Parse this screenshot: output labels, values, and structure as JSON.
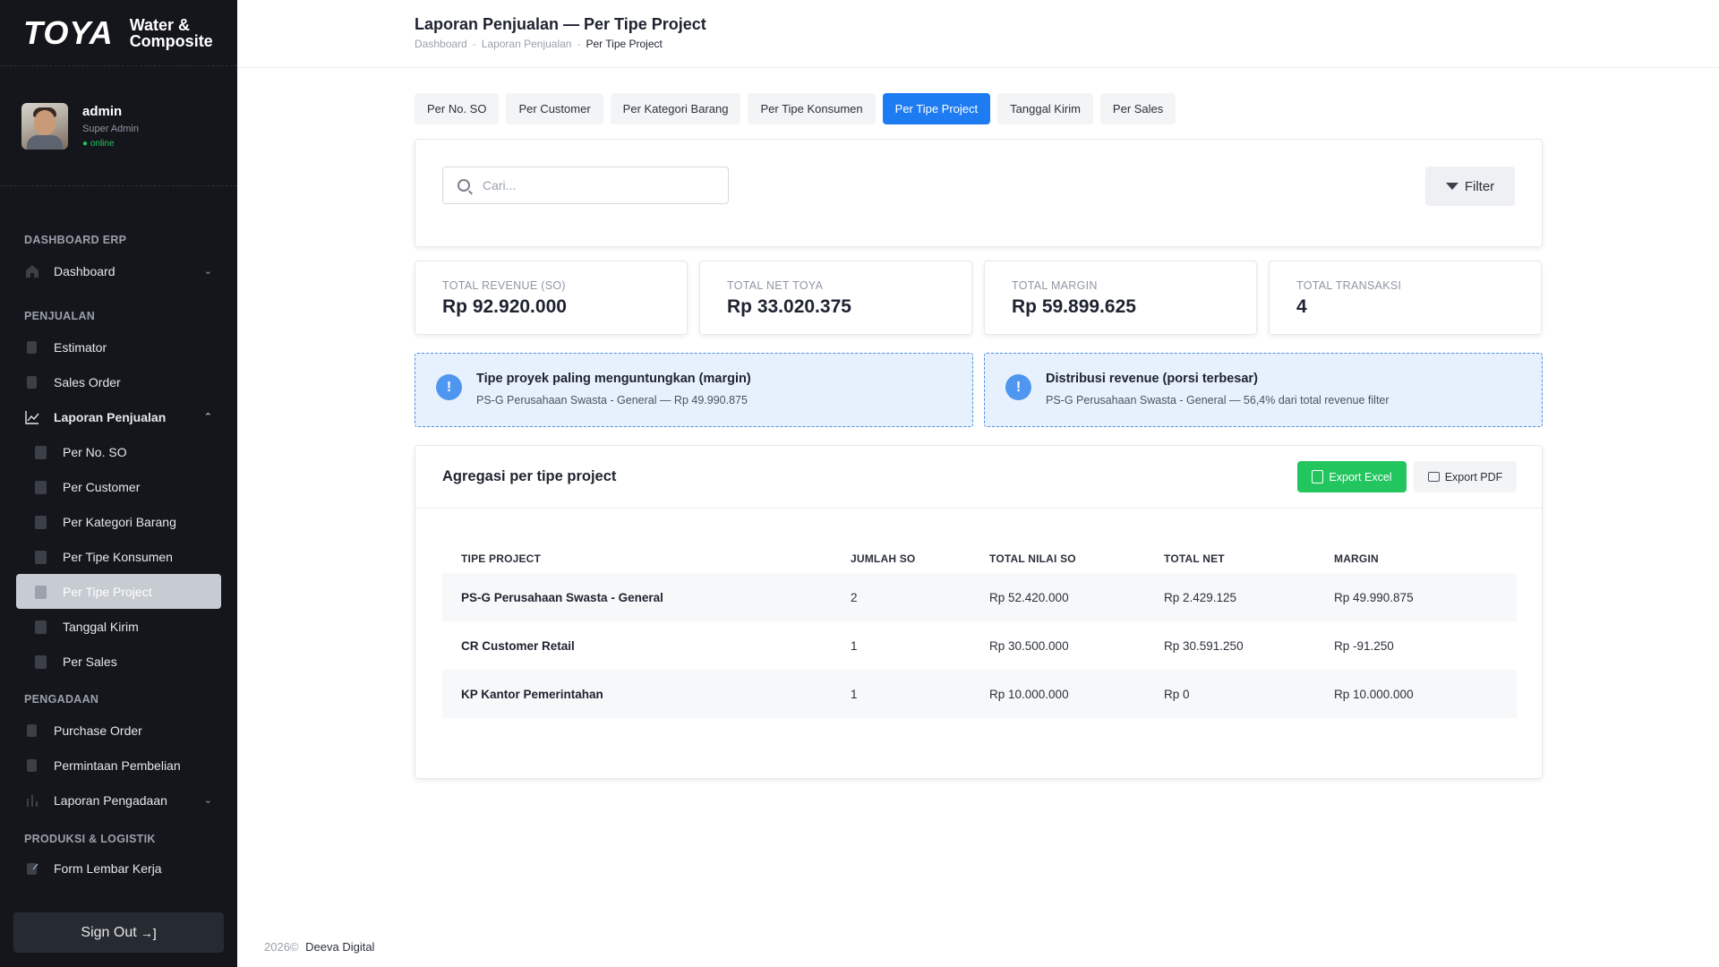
{
  "brand": {
    "logo": "TOYA",
    "subtitle_line1": "Water &",
    "subtitle_line2": "Composite"
  },
  "user": {
    "name": "admin",
    "role": "Super Admin",
    "status": "● online"
  },
  "sidebar": {
    "sections": [
      {
        "title": "DASHBOARD ERP"
      },
      {
        "title": "PENJUALAN"
      },
      {
        "title": "PENGADAAN"
      },
      {
        "title": "PRODUKSI & LOGISTIK"
      }
    ],
    "items": {
      "dashboard": "Dashboard",
      "estimator": "Estimator",
      "sales_order": "Sales Order",
      "laporan_penjualan": "Laporan Penjualan",
      "purchase_order": "Purchase Order",
      "permintaan_pembelian": "Permintaan Pembelian",
      "laporan_pengadaan": "Laporan Pengadaan",
      "form_lembar_kerja": "Form Lembar Kerja"
    },
    "sub_items": [
      "Per No. SO",
      "Per Customer",
      "Per Kategori Barang",
      "Per Tipe Konsumen",
      "Per Tipe Project",
      "Tanggal Kirim",
      "Per Sales"
    ],
    "active_sub": "Per Tipe Project",
    "signout": "Sign Out"
  },
  "header": {
    "title": "Laporan Penjualan — Per Tipe Project",
    "breadcrumb": [
      "Dashboard",
      "Laporan Penjualan",
      "Per Tipe Project"
    ]
  },
  "tabs": [
    "Per No. SO",
    "Per Customer",
    "Per Kategori Barang",
    "Per Tipe Konsumen",
    "Per Tipe Project",
    "Tanggal Kirim",
    "Per Sales"
  ],
  "active_tab": "Per Tipe Project",
  "search": {
    "placeholder": "Cari...",
    "value": ""
  },
  "filter_label": "Filter",
  "stats": [
    {
      "label": "TOTAL REVENUE (SO)",
      "value": "Rp 92.920.000"
    },
    {
      "label": "TOTAL NET TOYA",
      "value": "Rp 33.020.375"
    },
    {
      "label": "TOTAL MARGIN",
      "value": "Rp 59.899.625"
    },
    {
      "label": "TOTAL TRANSAKSI",
      "value": "4"
    }
  ],
  "insights": [
    {
      "icon": "!",
      "title": "Tipe proyek paling menguntungkan (margin)",
      "text": "PS-G Perusahaan Swasta - General — Rp 49.990.875"
    },
    {
      "icon": "!",
      "title": "Distribusi revenue (porsi terbesar)",
      "text": "PS-G Perusahaan Swasta - General — 56,4% dari total revenue filter"
    }
  ],
  "table": {
    "title": "Agregasi per tipe project",
    "export_excel": "Export Excel",
    "export_pdf": "Export PDF",
    "columns": [
      "TIPE PROJECT",
      "JUMLAH SO",
      "TOTAL NILAI SO",
      "TOTAL NET",
      "MARGIN"
    ],
    "rows": [
      [
        "PS-G Perusahaan Swasta - General",
        "2",
        "Rp 52.420.000",
        "Rp 2.429.125",
        "Rp 49.990.875"
      ],
      [
        "CR Customer Retail",
        "1",
        "Rp 30.500.000",
        "Rp 30.591.250",
        "Rp -91.250"
      ],
      [
        "KP Kantor Pemerintahan",
        "1",
        "Rp 10.000.000",
        "Rp 0",
        "Rp 10.000.000"
      ]
    ]
  },
  "footer": {
    "year": "2026©",
    "company": "Deeva Digital"
  },
  "colors": {
    "accent": "#1e7cf2",
    "sidebar_bg": "#14161b",
    "excel_green": "#22c55e",
    "info_bg": "#e7f1fd"
  }
}
